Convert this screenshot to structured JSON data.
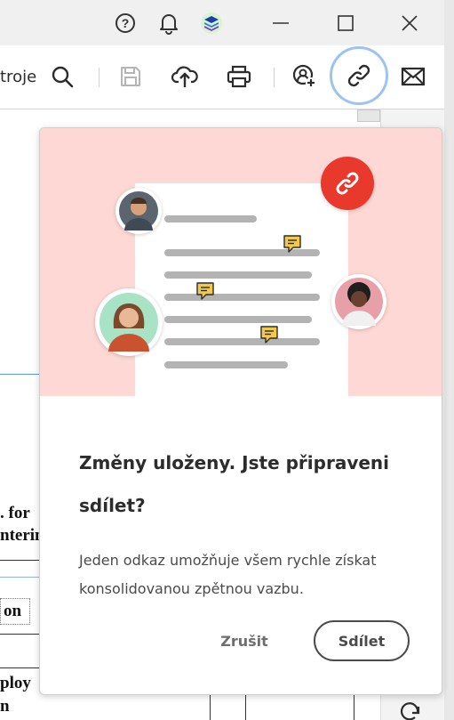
{
  "toolbar": {
    "tools_label": "troje"
  },
  "document_fragments": {
    "line1": ". for",
    "line2": "nterin",
    "line3": "on",
    "line4": "ploy",
    "line5": "n"
  },
  "popover": {
    "title": "Změny uloženy. Jste připraveni sdílet?",
    "body": "Jeden odkaz umožňuje všem rychle získat konsolidovanou zpětnou vazbu.",
    "cancel_label": "Zrušit",
    "share_label": "Sdílet"
  },
  "colors": {
    "illustration_bg": "#fdd8d5",
    "link_badge": "#e8392c",
    "chat_icon": "#f2c94c",
    "active_ring": "#9cc3f2"
  },
  "icons": {
    "titlebar": [
      "help-icon",
      "bell-icon",
      "app-layers-icon",
      "minimize-icon",
      "maximize-icon",
      "close-icon"
    ],
    "toolbar": [
      "search-icon",
      "save-icon",
      "cloud-upload-icon",
      "print-icon",
      "add-user-icon",
      "link-icon",
      "mail-icon"
    ]
  }
}
